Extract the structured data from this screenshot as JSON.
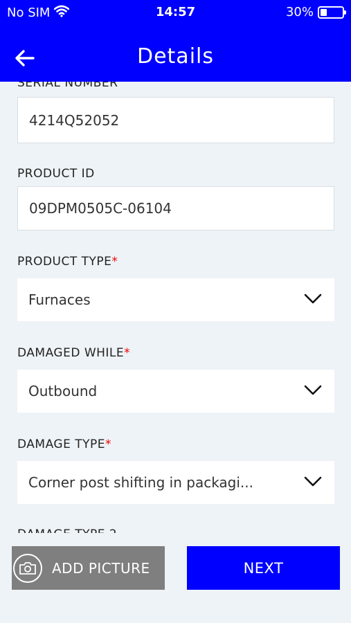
{
  "status_bar": {
    "carrier": "No SIM",
    "time": "14:57",
    "battery": "30%",
    "battery_level": 0.3
  },
  "header": {
    "title": "Details",
    "back_icon": "arrow-left-icon"
  },
  "form": {
    "serial_number": {
      "label": "SERIAL NUMBER",
      "value": "4214Q52052"
    },
    "product_id": {
      "label": "PRODUCT ID",
      "value": "09DPM0505C-06104"
    },
    "product_type": {
      "label": "PRODUCT TYPE",
      "required": "*",
      "value": "Furnaces"
    },
    "damaged_while": {
      "label": "DAMAGED WHILE",
      "required": "*",
      "value": "Outbound"
    },
    "damage_type": {
      "label": "DAMAGE TYPE",
      "required": "*",
      "value": "Corner post shifting in packagi..."
    },
    "damage_type_2": {
      "label": "DAMAGE TYPE 2"
    }
  },
  "actions": {
    "add_picture": "ADD PICTURE",
    "next": "NEXT"
  },
  "colors": {
    "primary": "#0000ff",
    "add_picture_bg": "#7f7f7f",
    "background": "#eef3f7",
    "required": "#e00000"
  }
}
